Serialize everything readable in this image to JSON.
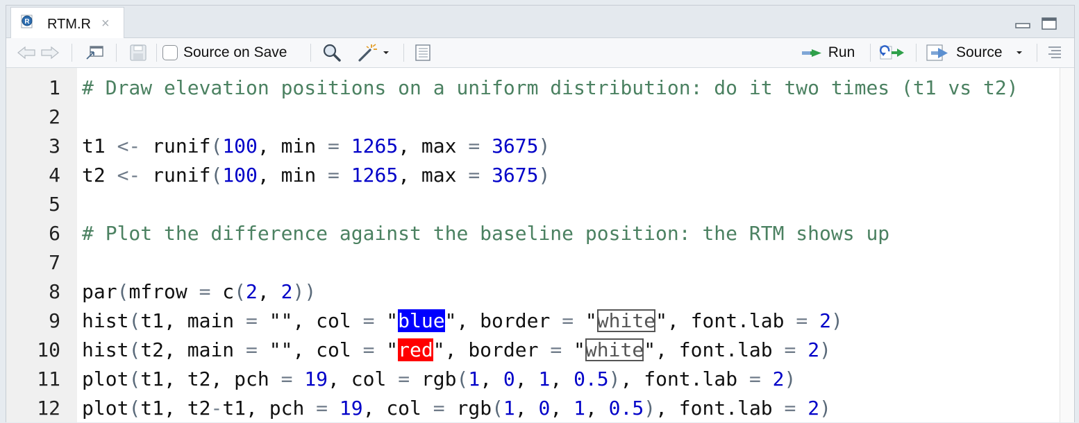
{
  "tab": {
    "title": "RTM.R",
    "close": "×",
    "icon": "r-file-icon"
  },
  "toolbar": {
    "back_icon": "arrow-left-icon",
    "forward_icon": "arrow-right-icon",
    "show_in_window_icon": "show-in-new-window-icon",
    "save_icon": "floppy-disk-icon",
    "source_on_save_label": "Source on Save",
    "source_on_save_checked": false,
    "find_icon": "magnifier-icon",
    "code_tools_icon": "magic-wand-icon",
    "compile_report_icon": "notebook-icon",
    "run_label": "Run",
    "rerun_icon": "rerun-icon",
    "source_label": "Source",
    "outline_icon": "outline-icon"
  },
  "colors": {
    "comment": "#4b8161",
    "number": "#0000c8",
    "operator": "#6f7b89",
    "swatch_blue": "#0000ff",
    "swatch_red": "#ff0000"
  },
  "editor": {
    "lines": [
      {
        "n": "1",
        "tokens": [
          [
            "c",
            "# Draw elevation positions on a uniform distribution: do it two times (t1 vs t2)"
          ]
        ]
      },
      {
        "n": "2",
        "tokens": []
      },
      {
        "n": "3",
        "tokens": [
          [
            "",
            "t1 "
          ],
          [
            "o",
            "<-"
          ],
          [
            "",
            " runif"
          ],
          [
            "p",
            "("
          ],
          [
            "n",
            "100"
          ],
          [
            "",
            ", min "
          ],
          [
            "o",
            "="
          ],
          [
            "",
            " "
          ],
          [
            "n",
            "1265"
          ],
          [
            "",
            ", max "
          ],
          [
            "o",
            "="
          ],
          [
            "",
            " "
          ],
          [
            "n",
            "3675"
          ],
          [
            "p",
            ")"
          ]
        ]
      },
      {
        "n": "4",
        "tokens": [
          [
            "",
            "t2 "
          ],
          [
            "o",
            "<-"
          ],
          [
            "",
            " runif"
          ],
          [
            "p",
            "("
          ],
          [
            "n",
            "100"
          ],
          [
            "",
            ", min "
          ],
          [
            "o",
            "="
          ],
          [
            "",
            " "
          ],
          [
            "n",
            "1265"
          ],
          [
            "",
            ", max "
          ],
          [
            "o",
            "="
          ],
          [
            "",
            " "
          ],
          [
            "n",
            "3675"
          ],
          [
            "p",
            ")"
          ]
        ]
      },
      {
        "n": "5",
        "tokens": []
      },
      {
        "n": "6",
        "tokens": [
          [
            "c",
            "# Plot the difference against the baseline position: the RTM shows up"
          ]
        ]
      },
      {
        "n": "7",
        "tokens": []
      },
      {
        "n": "8",
        "tokens": [
          [
            "",
            "par"
          ],
          [
            "p",
            "("
          ],
          [
            "",
            "mfrow "
          ],
          [
            "o",
            "="
          ],
          [
            "",
            " c"
          ],
          [
            "p",
            "("
          ],
          [
            "n",
            "2"
          ],
          [
            "",
            ", "
          ],
          [
            "n",
            "2"
          ],
          [
            "p",
            "))"
          ]
        ]
      },
      {
        "n": "9",
        "tokens": [
          [
            "",
            "hist"
          ],
          [
            "p",
            "("
          ],
          [
            "",
            "t1, main "
          ],
          [
            "o",
            "="
          ],
          [
            "",
            " \"\", col "
          ],
          [
            "o",
            "="
          ],
          [
            "",
            " \""
          ],
          [
            "sw-blue",
            "blue"
          ],
          [
            "",
            "\", border "
          ],
          [
            "o",
            "="
          ],
          [
            "",
            " \""
          ],
          [
            "sw-white",
            "white"
          ],
          [
            "",
            "\", font.lab "
          ],
          [
            "o",
            "="
          ],
          [
            "",
            " "
          ],
          [
            "n",
            "2"
          ],
          [
            "p",
            ")"
          ]
        ]
      },
      {
        "n": "10",
        "tokens": [
          [
            "",
            "hist"
          ],
          [
            "p",
            "("
          ],
          [
            "",
            "t2, main "
          ],
          [
            "o",
            "="
          ],
          [
            "",
            " \"\", col "
          ],
          [
            "o",
            "="
          ],
          [
            "",
            " \""
          ],
          [
            "sw-red",
            "red"
          ],
          [
            "",
            "\", border "
          ],
          [
            "o",
            "="
          ],
          [
            "",
            " \""
          ],
          [
            "sw-white",
            "white"
          ],
          [
            "",
            "\", font.lab "
          ],
          [
            "o",
            "="
          ],
          [
            "",
            " "
          ],
          [
            "n",
            "2"
          ],
          [
            "p",
            ")"
          ]
        ]
      },
      {
        "n": "11",
        "tokens": [
          [
            "",
            "plot"
          ],
          [
            "p",
            "("
          ],
          [
            "",
            "t1, t2, pch "
          ],
          [
            "o",
            "="
          ],
          [
            "",
            " "
          ],
          [
            "n",
            "19"
          ],
          [
            "",
            ", col "
          ],
          [
            "o",
            "="
          ],
          [
            "",
            " rgb"
          ],
          [
            "p",
            "("
          ],
          [
            "n",
            "1"
          ],
          [
            "",
            ", "
          ],
          [
            "n",
            "0"
          ],
          [
            "",
            ", "
          ],
          [
            "n",
            "1"
          ],
          [
            "",
            ", "
          ],
          [
            "n",
            "0.5"
          ],
          [
            "p",
            ")"
          ],
          [
            "",
            ", font.lab "
          ],
          [
            "o",
            "="
          ],
          [
            "",
            " "
          ],
          [
            "n",
            "2"
          ],
          [
            "p",
            ")"
          ]
        ]
      },
      {
        "n": "12",
        "tokens": [
          [
            "",
            "plot"
          ],
          [
            "p",
            "("
          ],
          [
            "",
            "t1, t2"
          ],
          [
            "o",
            "-"
          ],
          [
            "",
            "t1, pch "
          ],
          [
            "o",
            "="
          ],
          [
            "",
            " "
          ],
          [
            "n",
            "19"
          ],
          [
            "",
            ", col "
          ],
          [
            "o",
            "="
          ],
          [
            "",
            " rgb"
          ],
          [
            "p",
            "("
          ],
          [
            "n",
            "1"
          ],
          [
            "",
            ", "
          ],
          [
            "n",
            "0"
          ],
          [
            "",
            ", "
          ],
          [
            "n",
            "1"
          ],
          [
            "",
            ", "
          ],
          [
            "n",
            "0.5"
          ],
          [
            "p",
            ")"
          ],
          [
            "",
            ", font.lab "
          ],
          [
            "o",
            "="
          ],
          [
            "",
            " "
          ],
          [
            "n",
            "2"
          ],
          [
            "p",
            ")"
          ]
        ]
      }
    ]
  }
}
